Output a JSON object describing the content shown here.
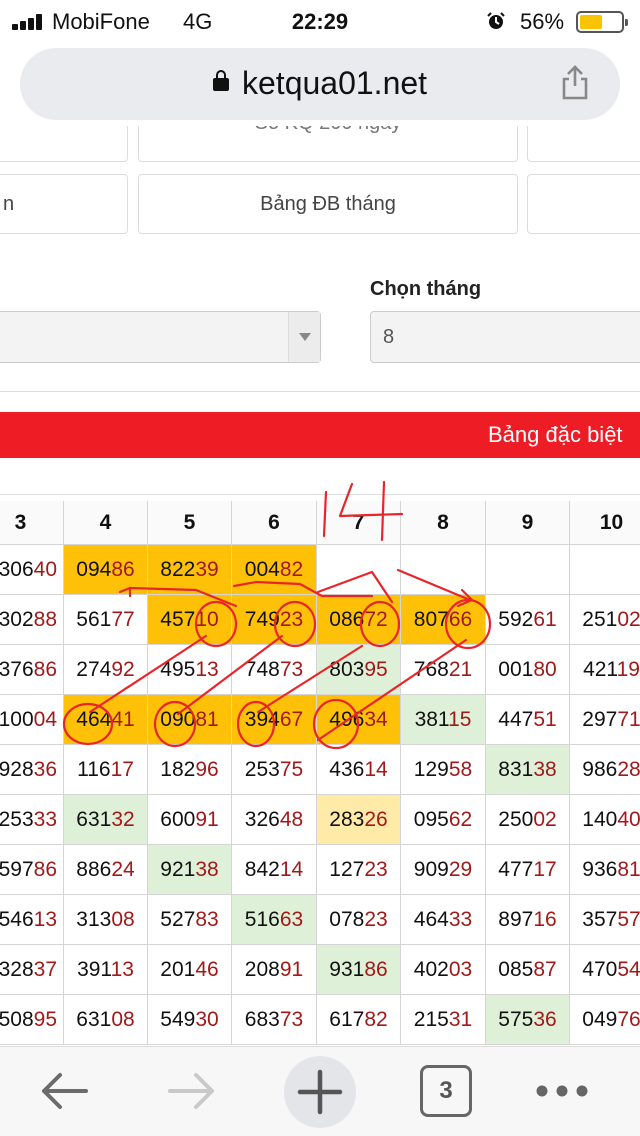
{
  "status_bar": {
    "carrier": "MobiFone",
    "network": "4G",
    "time": "22:29",
    "battery_percent": "56%",
    "battery_level": 0.56,
    "alarm_icon": "alarm-clock-icon",
    "signal_icon": "signal-bars-icon"
  },
  "browser": {
    "domain": "ketqua01.net",
    "lock_icon": "lock-icon",
    "share_icon": "share-icon",
    "open_tabs": "3"
  },
  "nav_buttons": {
    "row1_center": "Sổ KQ 200 ngày",
    "row2_left": "n",
    "row2_center": "Bảng ĐB tháng"
  },
  "filters": {
    "month_label": "Chọn tháng",
    "month_value": "8"
  },
  "banner": {
    "title": "Bảng đặc biệt"
  },
  "colors": {
    "banner_red": "#ee1c25",
    "highlight_yellow": "#ffc107",
    "highlight_green": "#dff0d8",
    "highlight_light_yellow": "#ffeaa8",
    "tail_digits_red": "#a11a1a",
    "scribble_red": "#e8262a"
  },
  "table": {
    "columns": [
      "3",
      "4",
      "5",
      "6",
      "7",
      "8",
      "9",
      "10"
    ],
    "rows": [
      [
        "30640",
        "09486",
        "82239",
        "00482",
        "",
        "",
        "",
        ""
      ],
      [
        "30288",
        "56177",
        "45710",
        "74923",
        "08672",
        "80766",
        "59261",
        "25102"
      ],
      [
        "37686",
        "27492",
        "49513",
        "74873",
        "80395",
        "76821",
        "00180",
        "42119"
      ],
      [
        "10004",
        "46441",
        "09081",
        "39467",
        "49634",
        "38115",
        "44751",
        "29771"
      ],
      [
        "92836",
        "11617",
        "18296",
        "25375",
        "43614",
        "12958",
        "83138",
        "98628"
      ],
      [
        "25333",
        "63132",
        "60091",
        "32648",
        "28326",
        "09562",
        "25002",
        "14040"
      ],
      [
        "59786",
        "88624",
        "92138",
        "84214",
        "12723",
        "90929",
        "47717",
        "93681"
      ],
      [
        "54613",
        "31308",
        "52783",
        "51663",
        "07823",
        "46433",
        "89716",
        "35757"
      ],
      [
        "32837",
        "39113",
        "20146",
        "20891",
        "93186",
        "40203",
        "08587",
        "47054"
      ],
      [
        "50895",
        "63108",
        "54930",
        "68373",
        "61782",
        "21531",
        "57536",
        "04976"
      ]
    ],
    "highlights": [
      [
        "",
        "yellow",
        "yellow",
        "yellow",
        "",
        "",
        "",
        ""
      ],
      [
        "",
        "",
        "yellow",
        "yellow",
        "yellow",
        "yellow",
        "",
        ""
      ],
      [
        "",
        "",
        "",
        "",
        "green",
        "",
        "",
        ""
      ],
      [
        "",
        "yellow",
        "yellow",
        "yellow",
        "yellow",
        "green",
        "",
        ""
      ],
      [
        "",
        "",
        "",
        "",
        "",
        "",
        "green",
        ""
      ],
      [
        "",
        "green",
        "",
        "",
        "lightyellow",
        "",
        "",
        ""
      ],
      [
        "",
        "",
        "green",
        "",
        "",
        "",
        "",
        ""
      ],
      [
        "",
        "",
        "",
        "green",
        "",
        "",
        "",
        ""
      ],
      [
        "",
        "",
        "",
        "",
        "green",
        "",
        "",
        ""
      ],
      [
        "",
        "",
        "",
        "",
        "",
        "",
        "green",
        ""
      ]
    ]
  },
  "annotation": {
    "handwritten_text": "14"
  }
}
